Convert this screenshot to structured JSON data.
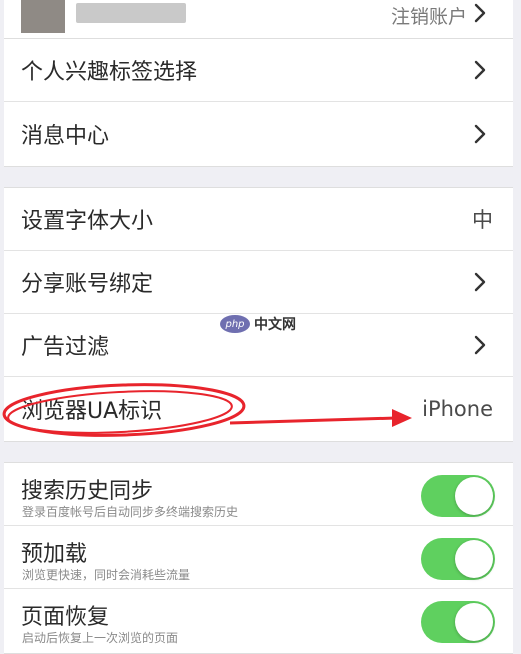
{
  "account": {
    "logout_label": "注销账户"
  },
  "group1": {
    "items": [
      {
        "label": "个人兴趣标签选择"
      },
      {
        "label": "消息中心"
      }
    ]
  },
  "group2": {
    "items": [
      {
        "label": "设置字体大小",
        "value": "中"
      },
      {
        "label": "分享账号绑定"
      },
      {
        "label": "广告过滤"
      },
      {
        "label": "浏览器UA标识",
        "value": "iPhone"
      }
    ]
  },
  "group3": {
    "items": [
      {
        "label": "搜索历史同步",
        "description": "登录百度帐号后自动同步多终端搜索历史",
        "enabled": true
      },
      {
        "label": "预加载",
        "description": "浏览更快速，同时会消耗些流量",
        "enabled": true
      },
      {
        "label": "页面恢复",
        "description": "启动后恢复上一次浏览的页面",
        "enabled": true
      }
    ]
  },
  "watermark": {
    "logo": "php",
    "text": "中文网"
  },
  "colors": {
    "toggle_on": "#5fd05f",
    "annotation": "#e8242c",
    "background": "#efeff4"
  }
}
